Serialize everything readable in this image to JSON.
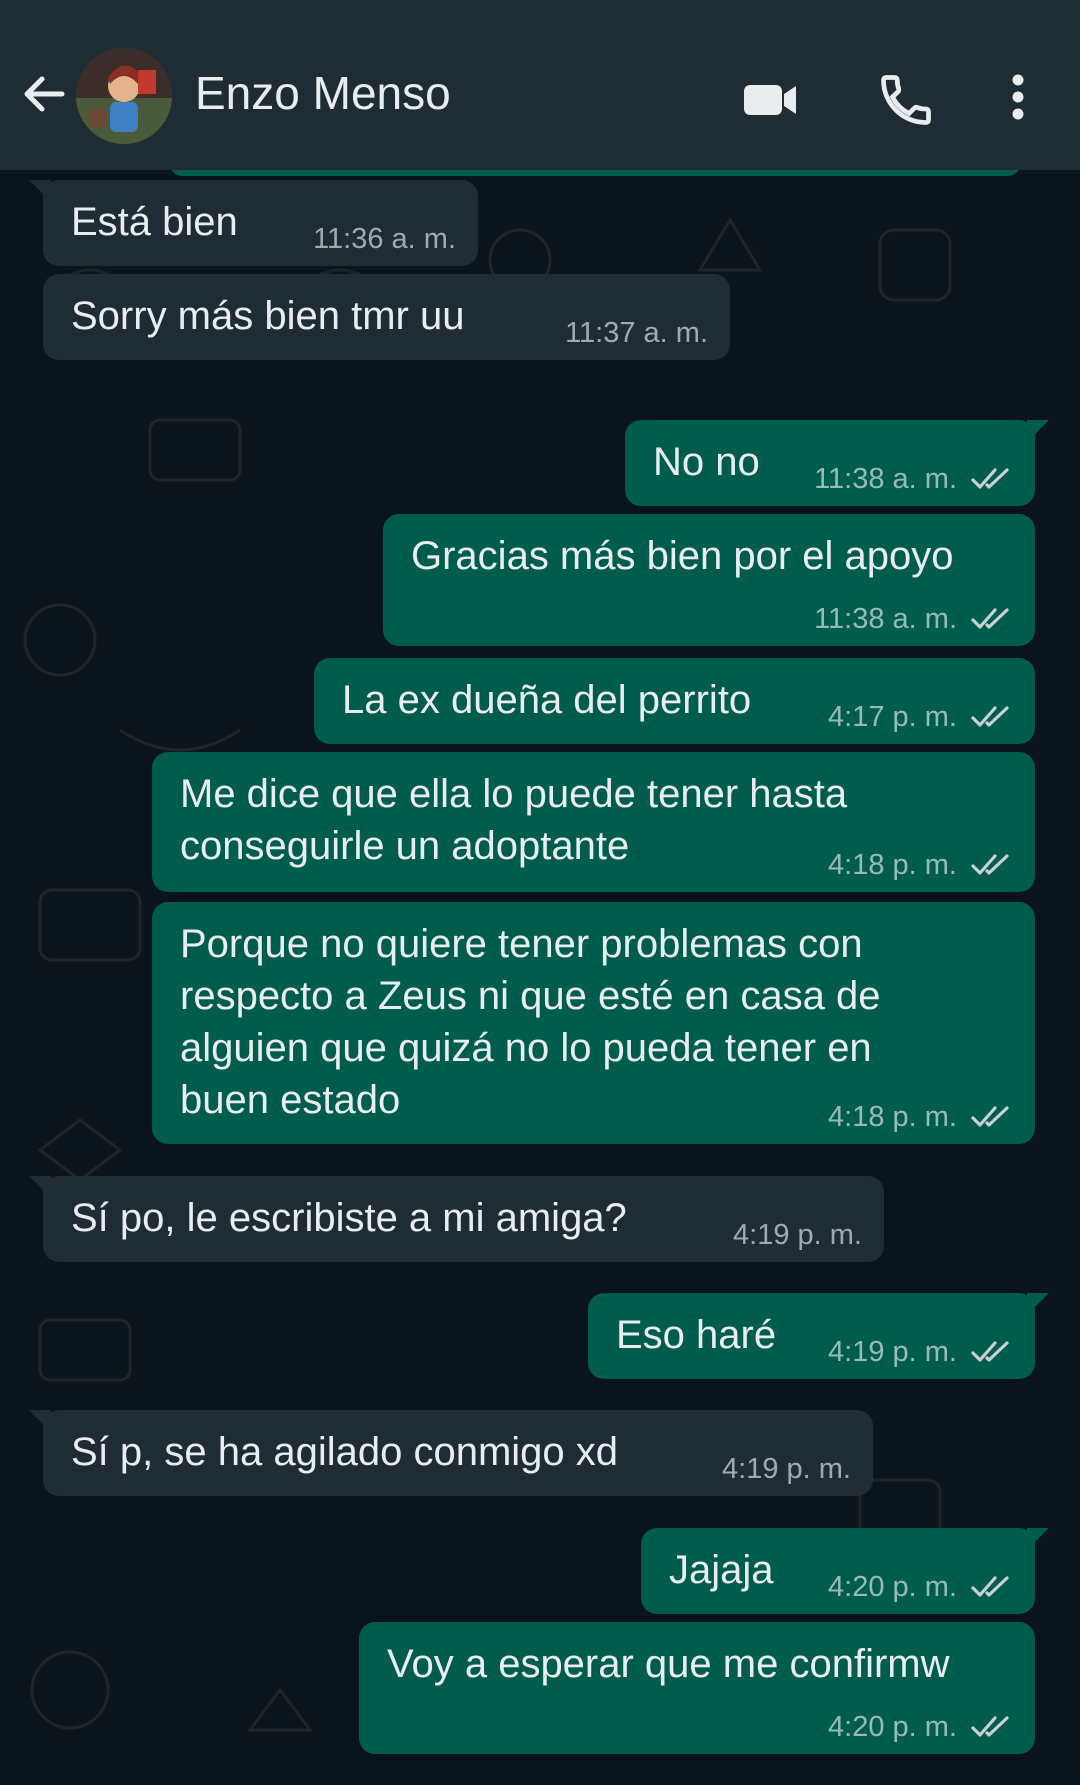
{
  "header": {
    "contact_name": "Enzo Menso",
    "back_icon": "arrow-left-icon",
    "video_icon": "video-camera-icon",
    "call_icon": "phone-icon",
    "menu_icon": "more-vertical-icon",
    "background_color": "#1f2c34"
  },
  "colors": {
    "chat_background": "#0b141a",
    "incoming_bubble": "#1f2c34",
    "outgoing_bubble": "#005c4b",
    "text": "#e9edef"
  },
  "messages": [
    {
      "direction": "in",
      "text": "Está bien",
      "time": "11:36 a. m."
    },
    {
      "direction": "in",
      "text": "Sorry más bien tmr uu",
      "time": "11:37 a. m."
    },
    {
      "direction": "out",
      "text": "No no",
      "time": "11:38 a. m.",
      "status": "read"
    },
    {
      "direction": "out",
      "text": "Gracias más bien por el apoyo",
      "time": "11:38 a. m.",
      "status": "read"
    },
    {
      "direction": "out",
      "text": "La ex dueña del perrito",
      "time": "4:17 p. m.",
      "status": "read"
    },
    {
      "direction": "out",
      "text": "Me dice que ella lo puede tener hasta\nconseguirle un adoptante",
      "time": "4:18 p. m.",
      "status": "read"
    },
    {
      "direction": "out",
      "text": "Porque no quiere tener problemas con\nrespecto a Zeus ni que esté en casa de\nalguien que quizá no lo pueda tener en\nbuen estado",
      "time": "4:18 p. m.",
      "status": "read"
    },
    {
      "direction": "in",
      "text": "Sí po, le escribiste a mi amiga?",
      "time": "4:19 p. m."
    },
    {
      "direction": "out",
      "text": "Eso haré",
      "time": "4:19 p. m.",
      "status": "read"
    },
    {
      "direction": "in",
      "text": "Sí p, se ha agilado conmigo xd",
      "time": "4:19 p. m."
    },
    {
      "direction": "out",
      "text": "Jajaja",
      "time": "4:20 p. m.",
      "status": "read"
    },
    {
      "direction": "out",
      "text": "Voy a esperar que me confirmw",
      "time": "4:20 p. m.",
      "status": "read"
    }
  ]
}
